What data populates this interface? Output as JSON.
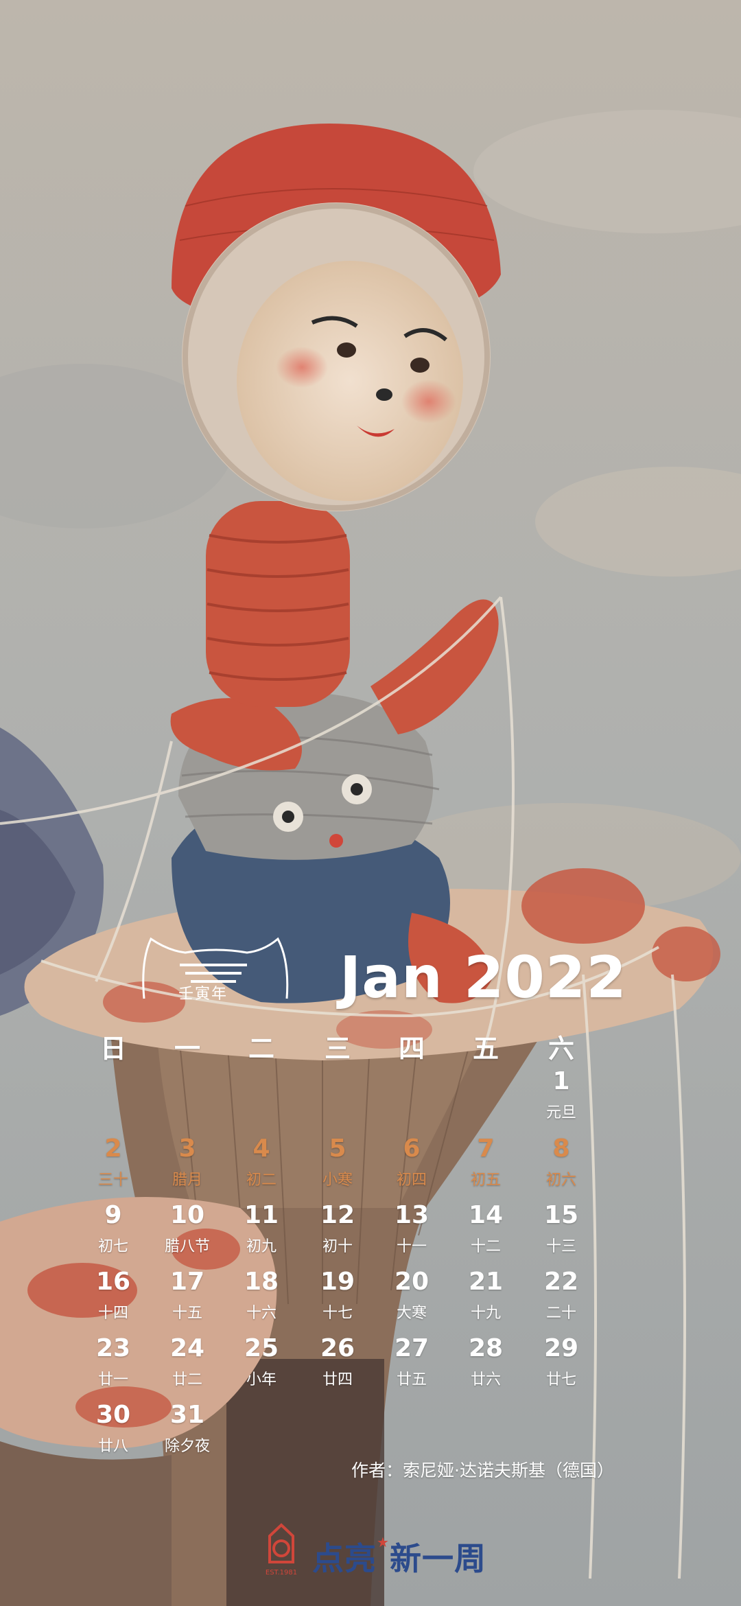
{
  "calendar": {
    "title": "Jan 2022",
    "year_badge": "壬寅年",
    "weekdays": [
      "日",
      "一",
      "二",
      "三",
      "四",
      "五",
      "六"
    ],
    "colors": {
      "text": "#ffffff",
      "holiday": "#d98a4c",
      "brand_blue": "#2c4b8c",
      "brand_red": "#d0463a"
    },
    "days": [
      {
        "d": "1",
        "l": "元旦",
        "col": 6,
        "row": 0,
        "h": false
      },
      {
        "d": "2",
        "l": "三十",
        "col": 0,
        "row": 1,
        "h": true
      },
      {
        "d": "3",
        "l": "腊月",
        "col": 1,
        "row": 1,
        "h": true
      },
      {
        "d": "4",
        "l": "初二",
        "col": 2,
        "row": 1,
        "h": true
      },
      {
        "d": "5",
        "l": "小寒",
        "col": 3,
        "row": 1,
        "h": true
      },
      {
        "d": "6",
        "l": "初四",
        "col": 4,
        "row": 1,
        "h": true
      },
      {
        "d": "7",
        "l": "初五",
        "col": 5,
        "row": 1,
        "h": true
      },
      {
        "d": "8",
        "l": "初六",
        "col": 6,
        "row": 1,
        "h": true
      },
      {
        "d": "9",
        "l": "初七",
        "col": 0,
        "row": 2,
        "h": false
      },
      {
        "d": "10",
        "l": "腊八节",
        "col": 1,
        "row": 2,
        "h": false
      },
      {
        "d": "11",
        "l": "初九",
        "col": 2,
        "row": 2,
        "h": false
      },
      {
        "d": "12",
        "l": "初十",
        "col": 3,
        "row": 2,
        "h": false
      },
      {
        "d": "13",
        "l": "十一",
        "col": 4,
        "row": 2,
        "h": false
      },
      {
        "d": "14",
        "l": "十二",
        "col": 5,
        "row": 2,
        "h": false
      },
      {
        "d": "15",
        "l": "十三",
        "col": 6,
        "row": 2,
        "h": false
      },
      {
        "d": "16",
        "l": "十四",
        "col": 0,
        "row": 3,
        "h": false
      },
      {
        "d": "17",
        "l": "十五",
        "col": 1,
        "row": 3,
        "h": false
      },
      {
        "d": "18",
        "l": "十六",
        "col": 2,
        "row": 3,
        "h": false
      },
      {
        "d": "19",
        "l": "十七",
        "col": 3,
        "row": 3,
        "h": false
      },
      {
        "d": "20",
        "l": "大寒",
        "col": 4,
        "row": 3,
        "h": false
      },
      {
        "d": "21",
        "l": "十九",
        "col": 5,
        "row": 3,
        "h": false
      },
      {
        "d": "22",
        "l": "二十",
        "col": 6,
        "row": 3,
        "h": false
      },
      {
        "d": "23",
        "l": "廿一",
        "col": 0,
        "row": 4,
        "h": false
      },
      {
        "d": "24",
        "l": "廿二",
        "col": 1,
        "row": 4,
        "h": false
      },
      {
        "d": "25",
        "l": "小年",
        "col": 2,
        "row": 4,
        "h": false
      },
      {
        "d": "26",
        "l": "廿四",
        "col": 3,
        "row": 4,
        "h": false
      },
      {
        "d": "27",
        "l": "廿五",
        "col": 4,
        "row": 4,
        "h": false
      },
      {
        "d": "28",
        "l": "廿六",
        "col": 5,
        "row": 4,
        "h": false
      },
      {
        "d": "29",
        "l": "廿七",
        "col": 6,
        "row": 4,
        "h": false
      },
      {
        "d": "30",
        "l": "廿八",
        "col": 0,
        "row": 5,
        "h": false
      },
      {
        "d": "31",
        "l": "除夕夜",
        "col": 1,
        "row": 5,
        "h": false
      }
    ]
  },
  "credit": "作者：索尼娅·达诺夫斯基（德国）",
  "brand": {
    "name_part1": "点亮",
    "name_part2": "新一周",
    "est": "EST.1981"
  }
}
